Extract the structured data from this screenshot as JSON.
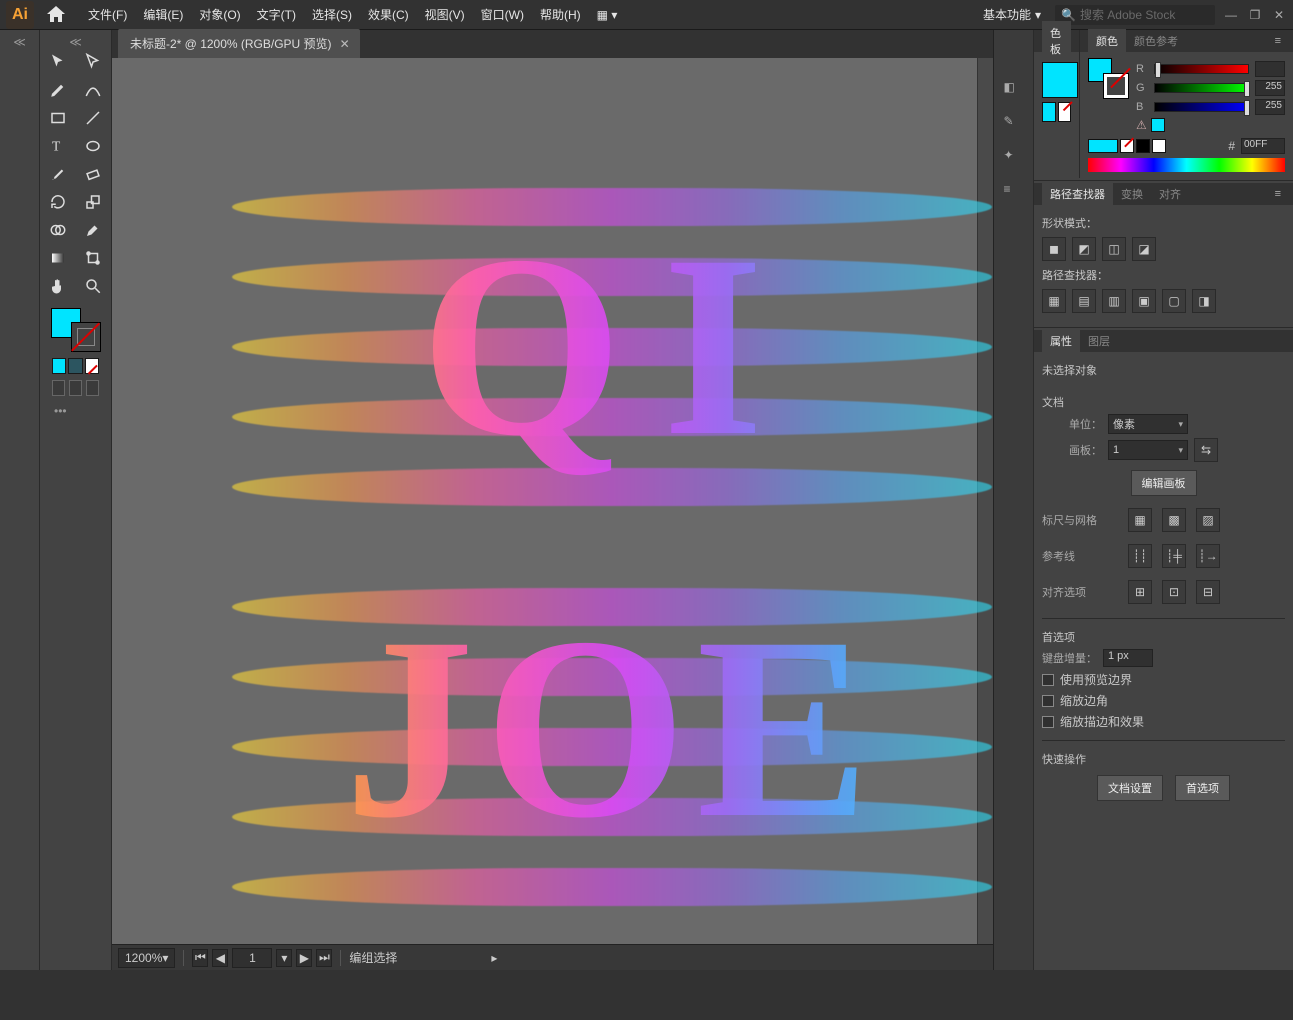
{
  "menubar": {
    "app_logo_text": "Ai",
    "items": [
      "文件(F)",
      "编辑(E)",
      "对象(O)",
      "文字(T)",
      "选择(S)",
      "效果(C)",
      "视图(V)",
      "窗口(W)",
      "帮助(H)"
    ],
    "workspace": "基本功能",
    "search_placeholder": "搜索 Adobe Stock"
  },
  "document": {
    "tab_title": "未标题-2* @ 1200% (RGB/GPU 预览)",
    "artwork_text_1": "QI",
    "artwork_text_2": "JOE"
  },
  "status": {
    "zoom": "1200%",
    "artboard_current": "1",
    "mode_label": "编组选择"
  },
  "swatches_panel": {
    "title": "色板"
  },
  "color_panel": {
    "tab_color": "颜色",
    "tab_guide": "颜色参考",
    "r_label": "R",
    "r_val": "",
    "g_label": "G",
    "g_val": "255",
    "b_label": "B",
    "b_val": "255",
    "hex_label": "#",
    "hex_val": "00FF"
  },
  "pathfinder": {
    "tab_pf": "路径查找器",
    "tab_transform": "变换",
    "tab_align": "对齐",
    "shape_modes": "形状模式：",
    "pathfinders": "路径查找器："
  },
  "properties": {
    "tab_props": "属性",
    "tab_layers": "图层",
    "no_selection": "未选择对象",
    "doc_section": "文档",
    "units_label": "单位：",
    "units_value": "像素",
    "artboard_label": "画板：",
    "artboard_value": "1",
    "edit_artboards": "编辑画板",
    "rulers_grid": "标尺与网格",
    "guides": "参考线",
    "align_options": "对齐选项",
    "prefs_section": "首选项",
    "key_increment": "键盘增量：",
    "key_increment_val": "1 px",
    "use_preview_bounds": "使用预览边界",
    "scale_corners": "缩放边角",
    "scale_strokes": "缩放描边和效果",
    "quick_actions": "快速操作",
    "doc_setup_btn": "文档设置",
    "prefs_btn": "首选项"
  }
}
